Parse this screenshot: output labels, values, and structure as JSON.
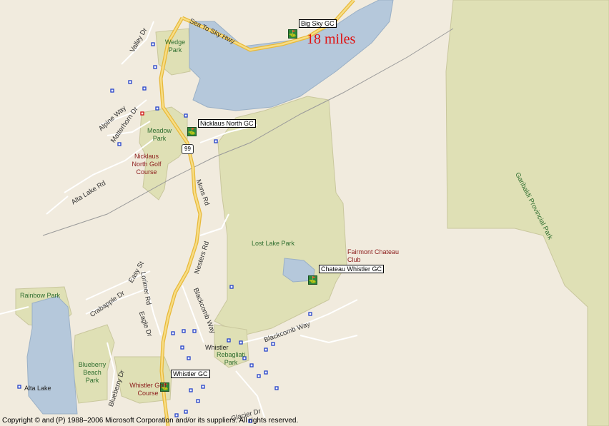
{
  "map": {
    "distance_note": "18 miles",
    "copyright": "Copyright © and (P) 1988–2006 Microsoft Corporation and/or its suppliers. All rights reserved.",
    "highway_shield": "99",
    "poi": {
      "big_sky": "Big Sky GC",
      "nicklaus_north": "Nicklaus North GC",
      "chateau_whistler": "Chateau Whistler GC",
      "whistler": "Whistler GC"
    },
    "parks": {
      "wedge": "Wedge Park",
      "meadow": "Meadow Park",
      "lost_lake": "Lost Lake Park",
      "rainbow": "Rainbow Park",
      "blueberry_beach": "Blueberry Beach Park",
      "rebagliati": "Rebagliati Park",
      "garibaldi": "Garibaldi Provincial Park"
    },
    "golf_areas": {
      "nicklaus": "Nicklaus North Golf Course",
      "fairmont": "Fairmont Chateau Club",
      "whistler": "Whistler Golf Course"
    },
    "places": {
      "whistler": "Whistler",
      "alta_lake": "Alta Lake"
    },
    "streets": {
      "sea_to_sky": "Sea To Sky Hwy",
      "valley": "Valley Dr",
      "alpine": "Alpine Way",
      "matterhorn": "Matterhorn Dr",
      "alta_lake_rd": "Alta Lake Rd",
      "mons": "Mons Rd",
      "nesters": "Nesters Rd",
      "easy": "Easy St",
      "crabapple": "Crabapple Dr",
      "lorimer": "Lorimer Rd",
      "eagle": "Eagle Dr",
      "blackcomb_way": "Blackcomb Way",
      "blackcomb_way2": "Blackcomb Way",
      "blueberry": "Blueberry Dr",
      "glacier": "Glacier Dr"
    },
    "colors": {
      "land": "#f1ebde",
      "water": "#b5c8db",
      "park": "#dfe0b5",
      "road": "#ffffff",
      "highway": "#f2c94c",
      "golf_icon": "#2e8a3a",
      "distance_text": "#e01010"
    }
  }
}
